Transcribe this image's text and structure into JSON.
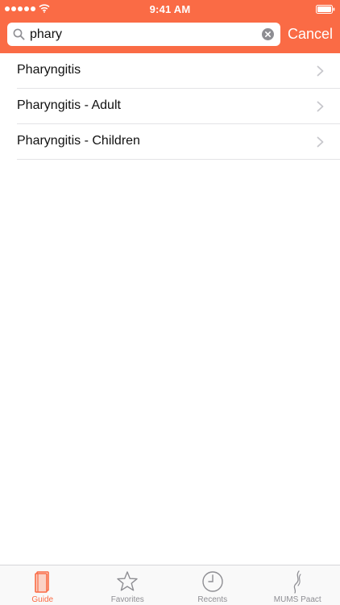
{
  "status_bar": {
    "time": "9:41 AM"
  },
  "search": {
    "value": "phary",
    "cancel_label": "Cancel"
  },
  "results": [
    {
      "label": "Pharyngitis"
    },
    {
      "label": "Pharyngitis - Adult"
    },
    {
      "label": "Pharyngitis - Children"
    }
  ],
  "tabs": [
    {
      "label": "Guide",
      "icon": "book-icon",
      "active": true
    },
    {
      "label": "Favorites",
      "icon": "star-icon",
      "active": false
    },
    {
      "label": "Recents",
      "icon": "clock-icon",
      "active": false
    },
    {
      "label": "MUMS Paact",
      "icon": "mums-logo-icon",
      "active": false
    }
  ],
  "colors": {
    "accent": "#fa6b45",
    "inactive": "#8e8e93"
  }
}
